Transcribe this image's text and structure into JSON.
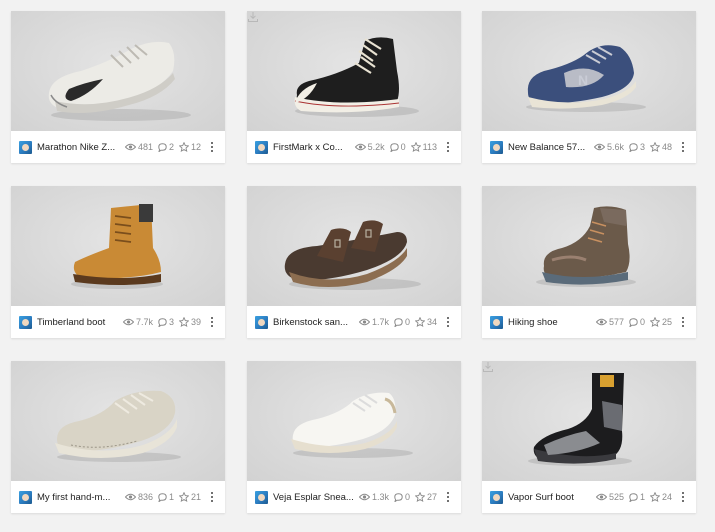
{
  "models": [
    {
      "title": "Marathon Nike Z...",
      "views": "481",
      "comments": "2",
      "likes": "12",
      "icon": "running-shoe",
      "download": false
    },
    {
      "title": "FirstMark x Co...",
      "views": "5.2k",
      "comments": "0",
      "likes": "113",
      "icon": "high-top-sneaker",
      "download": true
    },
    {
      "title": "New Balance 57...",
      "views": "5.6k",
      "comments": "3",
      "likes": "48",
      "icon": "sneaker",
      "download": false
    },
    {
      "title": "Timberland boot",
      "views": "7.7k",
      "comments": "3",
      "likes": "39",
      "icon": "boot",
      "download": false
    },
    {
      "title": "Birkenstock san...",
      "views": "1.7k",
      "comments": "0",
      "likes": "34",
      "icon": "sandal",
      "download": false
    },
    {
      "title": "Hiking shoe",
      "views": "577",
      "comments": "0",
      "likes": "25",
      "icon": "hiking-shoe",
      "download": false
    },
    {
      "title": "My first hand-m...",
      "views": "836",
      "comments": "1",
      "likes": "21",
      "icon": "worn-sneaker",
      "download": false
    },
    {
      "title": "Veja Esplar Snea...",
      "views": "1.3k",
      "comments": "0",
      "likes": "27",
      "icon": "white-sneaker",
      "download": false
    },
    {
      "title": "Vapor Surf boot",
      "views": "525",
      "comments": "1",
      "likes": "24",
      "icon": "surf-boot",
      "download": true
    }
  ],
  "colors": {
    "background": "#f2f2f2",
    "card": "#ffffff",
    "thumbnail_bg": "#dcdcdc",
    "title_text": "#222222",
    "stat_text": "#8a8a8a"
  }
}
